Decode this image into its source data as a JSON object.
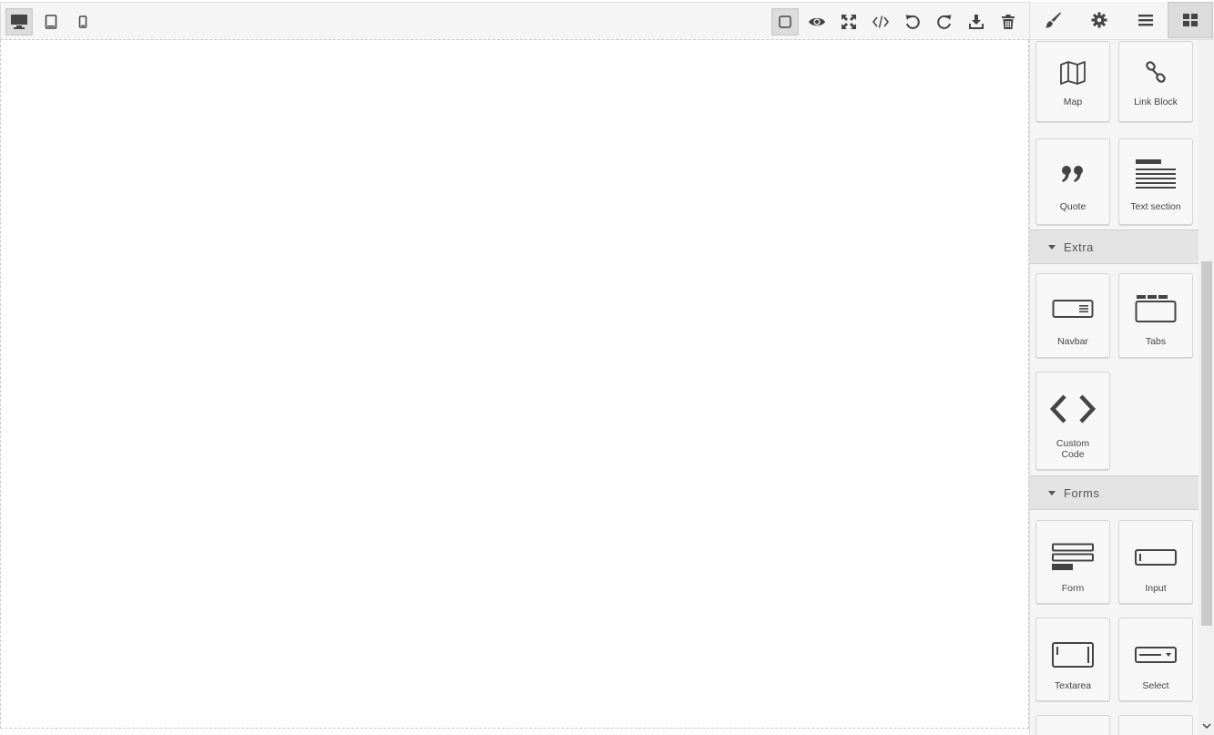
{
  "toolbar": {
    "devices": [
      {
        "name": "desktop-icon",
        "active": true
      },
      {
        "name": "tablet-icon",
        "active": false
      },
      {
        "name": "mobile-icon",
        "active": false
      }
    ],
    "actions": [
      {
        "name": "sw-visibility-icon",
        "active": true
      },
      {
        "name": "preview-icon",
        "active": false
      },
      {
        "name": "fullscreen-icon",
        "active": false
      },
      {
        "name": "code-icon",
        "active": false
      },
      {
        "name": "undo-icon",
        "active": false
      },
      {
        "name": "redo-icon",
        "active": false
      },
      {
        "name": "download-icon",
        "active": false
      },
      {
        "name": "trash-icon",
        "active": false
      }
    ]
  },
  "panel": {
    "tabs": [
      {
        "name": "paint-brush-icon",
        "active": false
      },
      {
        "name": "gear-icon",
        "active": false
      },
      {
        "name": "bars-icon",
        "active": false
      },
      {
        "name": "blocks-grid-icon",
        "active": true
      }
    ],
    "basic_blocks": [
      {
        "label": "Map",
        "icon": "map-icon"
      },
      {
        "label": "Link Block",
        "icon": "link-icon"
      },
      {
        "label": "Quote",
        "icon": "quote-icon"
      },
      {
        "label": "Text section",
        "icon": "text-section-icon"
      }
    ],
    "categories": [
      {
        "label": "Extra",
        "blocks": [
          {
            "label": "Navbar",
            "icon": "navbar-icon"
          },
          {
            "label": "Tabs",
            "icon": "tabs-icon"
          },
          {
            "label": "Custom Code",
            "icon": "custom-code-icon"
          }
        ]
      },
      {
        "label": "Forms",
        "blocks": [
          {
            "label": "Form",
            "icon": "form-icon"
          },
          {
            "label": "Input",
            "icon": "input-icon"
          },
          {
            "label": "Textarea",
            "icon": "textarea-icon"
          },
          {
            "label": "Select",
            "icon": "select-icon"
          }
        ]
      }
    ]
  },
  "colors": {
    "icon": "#444444",
    "panel_bg": "#f5f5f5",
    "active_bg": "#dcdcdc",
    "category_bg": "#e3e3e3"
  }
}
